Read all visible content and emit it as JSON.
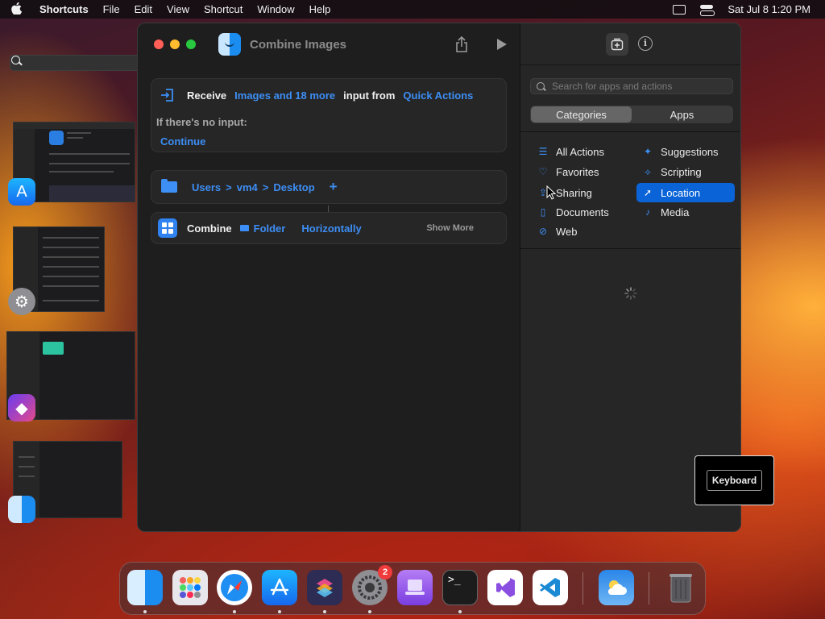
{
  "menubar": {
    "app_name": "Shortcuts",
    "items": [
      "File",
      "Edit",
      "View",
      "Shortcut",
      "Window",
      "Help"
    ],
    "clock": "Sat Jul 8  1:20 PM"
  },
  "window": {
    "title": "Combine Images",
    "receive": {
      "label": "Receive",
      "types": "Images and 18 more",
      "input_from": "input from",
      "source": "Quick Actions",
      "no_input": "If there's no input:",
      "continue": "Continue"
    },
    "path": {
      "segments": [
        "Users",
        "vm4",
        "Desktop"
      ],
      "sep": ">",
      "add": "+"
    },
    "combine": {
      "label": "Combine",
      "folder": "Folder",
      "direction": "Horizontally",
      "show_more": "Show More"
    }
  },
  "sidebar": {
    "search_placeholder": "Search for apps and actions",
    "segments": [
      "Categories",
      "Apps"
    ],
    "active_segment": "Categories",
    "categories": [
      {
        "label": "All Actions",
        "icon": "list-icon"
      },
      {
        "label": "Suggestions",
        "icon": "sparkle-icon"
      },
      {
        "label": "Favorites",
        "icon": "heart-icon"
      },
      {
        "label": "Scripting",
        "icon": "scripting-icon"
      },
      {
        "label": "Sharing",
        "icon": "share-icon"
      },
      {
        "label": "Location",
        "icon": "location-arrow-icon",
        "selected": true
      },
      {
        "label": "Documents",
        "icon": "document-icon"
      },
      {
        "label": "Media",
        "icon": "music-note-icon"
      },
      {
        "label": "Web",
        "icon": "compass-icon"
      }
    ]
  },
  "overlay": {
    "keyboard_label": "Keyboard"
  },
  "dock": {
    "items": [
      "finder-icon",
      "launchpad-icon",
      "safari-icon",
      "app-store-icon",
      "shortcuts-icon",
      "system-settings-icon",
      "apple-configurator-icon",
      "terminal-icon",
      "visual-studio-icon",
      "vscode-icon",
      "weather-icon",
      "trash-icon"
    ],
    "settings_badge": "2"
  },
  "colors": {
    "accent": "#3d8ef5",
    "selection": "#0a64d8",
    "close": "#ff5f57",
    "minimize": "#febc2e",
    "zoom": "#28c840"
  }
}
